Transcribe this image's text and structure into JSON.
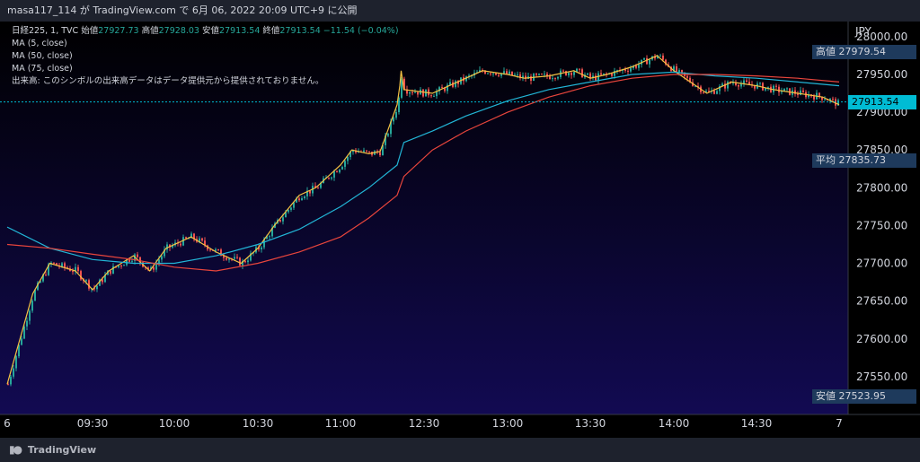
{
  "header": {
    "text": "masa117_114 が TradingView.com で 6月 06, 2022 20:09 UTC+9 に公開"
  },
  "legend": {
    "symbol": "日経225, 1, TVC",
    "open_label": "始値",
    "open_value": "27927.73",
    "high_label": "高値",
    "high_value": "27928.03",
    "low_label": "安値",
    "low_value": "27913.54",
    "close_label": "終値",
    "close_value": "27913.54",
    "change": "−11.54 (−0.04%)",
    "ma1": "MA (5, close)",
    "ma2": "MA (50, close)",
    "ma3": "MA (75, close)",
    "volume_note": "出来高: このシンボルの出来高データはデータ提供元から提供されておりません。"
  },
  "axis": {
    "currency": "JPY"
  },
  "tags": {
    "high": {
      "label": "高値",
      "value": "27979.54"
    },
    "current": {
      "value": "27913.54"
    },
    "avg": {
      "label": "平均",
      "value": "27835.73"
    },
    "low": {
      "label": "安値",
      "value": "27523.95"
    }
  },
  "footer": {
    "brand": "TradingView"
  },
  "colors": {
    "up": "#26a69a",
    "down": "#ef5350",
    "ma5": "#f5c243",
    "ma50": "#22b5d6",
    "ma75": "#e8453c",
    "bg_top": "#000000",
    "bg_bottom": "#120a52",
    "current": "#00bcd4",
    "tag": "#1e3a5c"
  },
  "chart_data": {
    "type": "line",
    "title": "",
    "xlabel": "",
    "ylabel": "JPY",
    "x_ticks": [
      "6",
      "09:30",
      "10:00",
      "10:30",
      "11:00",
      "12:30",
      "13:00",
      "13:30",
      "14:00",
      "14:30",
      "7"
    ],
    "y_ticks": [
      27550,
      27600,
      27650,
      27700,
      27750,
      27800,
      27850,
      27900,
      27950,
      28000
    ],
    "ylim": [
      27500,
      28020
    ],
    "series": [
      {
        "name": "MA (5, close)",
        "x": [
          9.0,
          9.15,
          9.25,
          9.4,
          9.5,
          9.6,
          9.75,
          9.85,
          9.95,
          10.1,
          10.25,
          10.4,
          10.5,
          10.6,
          10.75,
          10.85,
          11.0,
          11.1,
          11.25,
          11.35,
          11.5,
          11.6,
          11.65,
          11.75,
          12.55,
          12.65,
          12.75,
          12.85,
          13.0,
          13.1,
          13.25,
          13.4,
          13.5,
          13.6,
          13.75,
          13.9,
          14.0,
          14.1,
          14.2,
          14.35,
          14.5,
          14.6,
          14.75,
          14.9,
          15.0
        ],
        "y": [
          27540,
          27660,
          27700,
          27690,
          27665,
          27690,
          27710,
          27690,
          27720,
          27735,
          27715,
          27700,
          27720,
          27750,
          27790,
          27800,
          27830,
          27850,
          27845,
          27848,
          27910,
          27935,
          27955,
          27930,
          27925,
          27935,
          27945,
          27955,
          27950,
          27945,
          27948,
          27955,
          27945,
          27950,
          27960,
          27975,
          27955,
          27940,
          27925,
          27940,
          27935,
          27930,
          27925,
          27920,
          27910
        ]
      },
      {
        "name": "MA (50, close)",
        "x": [
          9.0,
          9.25,
          9.5,
          9.75,
          10.0,
          10.25,
          10.5,
          10.75,
          11.0,
          11.25,
          11.5,
          11.75,
          12.55,
          12.75,
          13.0,
          13.25,
          13.5,
          13.75,
          14.0,
          14.25,
          14.5,
          14.75,
          15.0
        ],
        "y": [
          27748,
          27720,
          27705,
          27700,
          27700,
          27710,
          27725,
          27745,
          27775,
          27800,
          27830,
          27860,
          27875,
          27895,
          27915,
          27930,
          27940,
          27950,
          27953,
          27948,
          27945,
          27940,
          27935
        ]
      },
      {
        "name": "MA (75, close)",
        "x": [
          9.0,
          9.25,
          9.5,
          9.75,
          10.0,
          10.25,
          10.5,
          10.75,
          11.0,
          11.25,
          11.5,
          11.75,
          12.55,
          12.75,
          13.0,
          13.25,
          13.5,
          13.75,
          14.0,
          14.25,
          14.5,
          14.75,
          15.0
        ],
        "y": [
          27725,
          27720,
          27712,
          27705,
          27695,
          27690,
          27700,
          27715,
          27735,
          27760,
          27790,
          27815,
          27850,
          27875,
          27900,
          27920,
          27935,
          27945,
          27950,
          27950,
          27948,
          27945,
          27940
        ]
      }
    ],
    "stats": {
      "high": 27979.54,
      "average": 27835.73,
      "low": 27523.95,
      "last": 27913.54
    },
    "legend_position": "top-left",
    "grid": false
  }
}
